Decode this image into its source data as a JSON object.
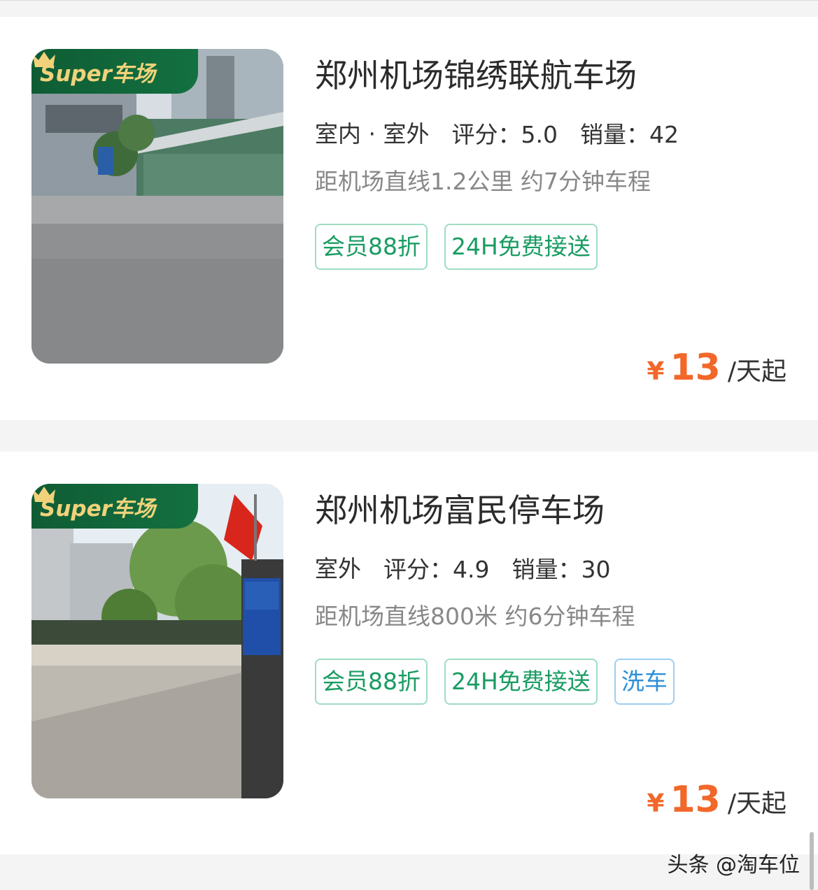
{
  "lots": [
    {
      "badge": "Super车场",
      "name": "郑州机场锦绣联航车场",
      "type": "室内 · 室外",
      "rating_label": "评分：",
      "rating": "5.0",
      "sales_label": "销量：",
      "sales": "42",
      "distance": "距机场直线1.2公里 约7分钟车程",
      "tags": [
        "会员88折",
        "24H免费接送"
      ],
      "price_currency": "¥",
      "price": "13",
      "price_unit": "/天起"
    },
    {
      "badge": "Super车场",
      "name": "郑州机场富民停车场",
      "type": "室外",
      "rating_label": "评分：",
      "rating": "4.9",
      "sales_label": "销量：",
      "sales": "30",
      "distance": "距机场直线800米 约6分钟车程",
      "tags": [
        "会员88折",
        "24H免费接送"
      ],
      "extra_tag": "洗车",
      "price_currency": "¥",
      "price": "13",
      "price_unit": "/天起"
    }
  ],
  "watermark": "头条 @淘车位",
  "colors": {
    "accent_green": "#1a9c63",
    "price_orange": "#f2672a",
    "badge_green": "#0f5c34",
    "badge_gold": "#f1d27a",
    "tag_blue": "#2c8fd8"
  }
}
